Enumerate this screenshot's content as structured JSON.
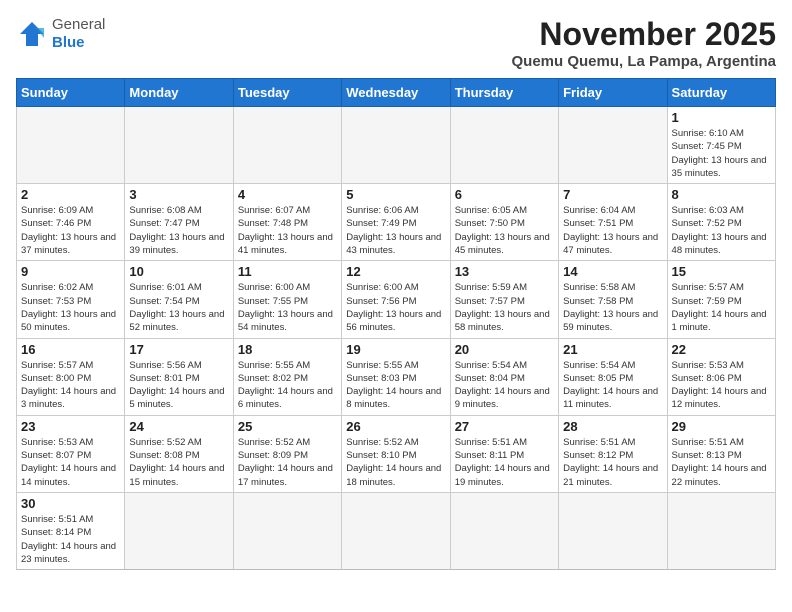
{
  "header": {
    "logo_general": "General",
    "logo_blue": "Blue",
    "month_title": "November 2025",
    "subtitle": "Quemu Quemu, La Pampa, Argentina"
  },
  "days_of_week": [
    "Sunday",
    "Monday",
    "Tuesday",
    "Wednesday",
    "Thursday",
    "Friday",
    "Saturday"
  ],
  "weeks": [
    [
      {
        "day": "",
        "info": ""
      },
      {
        "day": "",
        "info": ""
      },
      {
        "day": "",
        "info": ""
      },
      {
        "day": "",
        "info": ""
      },
      {
        "day": "",
        "info": ""
      },
      {
        "day": "",
        "info": ""
      },
      {
        "day": "1",
        "info": "Sunrise: 6:10 AM\nSunset: 7:45 PM\nDaylight: 13 hours and 35 minutes."
      }
    ],
    [
      {
        "day": "2",
        "info": "Sunrise: 6:09 AM\nSunset: 7:46 PM\nDaylight: 13 hours and 37 minutes."
      },
      {
        "day": "3",
        "info": "Sunrise: 6:08 AM\nSunset: 7:47 PM\nDaylight: 13 hours and 39 minutes."
      },
      {
        "day": "4",
        "info": "Sunrise: 6:07 AM\nSunset: 7:48 PM\nDaylight: 13 hours and 41 minutes."
      },
      {
        "day": "5",
        "info": "Sunrise: 6:06 AM\nSunset: 7:49 PM\nDaylight: 13 hours and 43 minutes."
      },
      {
        "day": "6",
        "info": "Sunrise: 6:05 AM\nSunset: 7:50 PM\nDaylight: 13 hours and 45 minutes."
      },
      {
        "day": "7",
        "info": "Sunrise: 6:04 AM\nSunset: 7:51 PM\nDaylight: 13 hours and 47 minutes."
      },
      {
        "day": "8",
        "info": "Sunrise: 6:03 AM\nSunset: 7:52 PM\nDaylight: 13 hours and 48 minutes."
      }
    ],
    [
      {
        "day": "9",
        "info": "Sunrise: 6:02 AM\nSunset: 7:53 PM\nDaylight: 13 hours and 50 minutes."
      },
      {
        "day": "10",
        "info": "Sunrise: 6:01 AM\nSunset: 7:54 PM\nDaylight: 13 hours and 52 minutes."
      },
      {
        "day": "11",
        "info": "Sunrise: 6:00 AM\nSunset: 7:55 PM\nDaylight: 13 hours and 54 minutes."
      },
      {
        "day": "12",
        "info": "Sunrise: 6:00 AM\nSunset: 7:56 PM\nDaylight: 13 hours and 56 minutes."
      },
      {
        "day": "13",
        "info": "Sunrise: 5:59 AM\nSunset: 7:57 PM\nDaylight: 13 hours and 58 minutes."
      },
      {
        "day": "14",
        "info": "Sunrise: 5:58 AM\nSunset: 7:58 PM\nDaylight: 13 hours and 59 minutes."
      },
      {
        "day": "15",
        "info": "Sunrise: 5:57 AM\nSunset: 7:59 PM\nDaylight: 14 hours and 1 minute."
      }
    ],
    [
      {
        "day": "16",
        "info": "Sunrise: 5:57 AM\nSunset: 8:00 PM\nDaylight: 14 hours and 3 minutes."
      },
      {
        "day": "17",
        "info": "Sunrise: 5:56 AM\nSunset: 8:01 PM\nDaylight: 14 hours and 5 minutes."
      },
      {
        "day": "18",
        "info": "Sunrise: 5:55 AM\nSunset: 8:02 PM\nDaylight: 14 hours and 6 minutes."
      },
      {
        "day": "19",
        "info": "Sunrise: 5:55 AM\nSunset: 8:03 PM\nDaylight: 14 hours and 8 minutes."
      },
      {
        "day": "20",
        "info": "Sunrise: 5:54 AM\nSunset: 8:04 PM\nDaylight: 14 hours and 9 minutes."
      },
      {
        "day": "21",
        "info": "Sunrise: 5:54 AM\nSunset: 8:05 PM\nDaylight: 14 hours and 11 minutes."
      },
      {
        "day": "22",
        "info": "Sunrise: 5:53 AM\nSunset: 8:06 PM\nDaylight: 14 hours and 12 minutes."
      }
    ],
    [
      {
        "day": "23",
        "info": "Sunrise: 5:53 AM\nSunset: 8:07 PM\nDaylight: 14 hours and 14 minutes."
      },
      {
        "day": "24",
        "info": "Sunrise: 5:52 AM\nSunset: 8:08 PM\nDaylight: 14 hours and 15 minutes."
      },
      {
        "day": "25",
        "info": "Sunrise: 5:52 AM\nSunset: 8:09 PM\nDaylight: 14 hours and 17 minutes."
      },
      {
        "day": "26",
        "info": "Sunrise: 5:52 AM\nSunset: 8:10 PM\nDaylight: 14 hours and 18 minutes."
      },
      {
        "day": "27",
        "info": "Sunrise: 5:51 AM\nSunset: 8:11 PM\nDaylight: 14 hours and 19 minutes."
      },
      {
        "day": "28",
        "info": "Sunrise: 5:51 AM\nSunset: 8:12 PM\nDaylight: 14 hours and 21 minutes."
      },
      {
        "day": "29",
        "info": "Sunrise: 5:51 AM\nSunset: 8:13 PM\nDaylight: 14 hours and 22 minutes."
      }
    ],
    [
      {
        "day": "30",
        "info": "Sunrise: 5:51 AM\nSunset: 8:14 PM\nDaylight: 14 hours and 23 minutes."
      },
      {
        "day": "",
        "info": ""
      },
      {
        "day": "",
        "info": ""
      },
      {
        "day": "",
        "info": ""
      },
      {
        "day": "",
        "info": ""
      },
      {
        "day": "",
        "info": ""
      },
      {
        "day": "",
        "info": ""
      }
    ]
  ]
}
